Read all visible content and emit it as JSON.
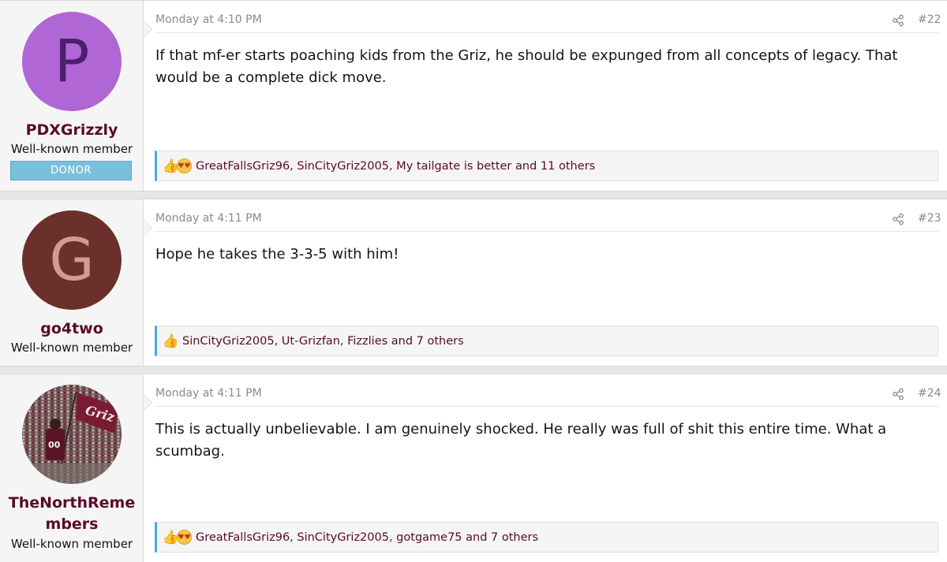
{
  "posts": [
    {
      "user": {
        "avatar_letter": "P",
        "avatar_bg": "#b066d4",
        "avatar_fg": "#4e1d6e",
        "username": "PDXGrizzly",
        "title": "Well-known member",
        "badge": "DONOR"
      },
      "date": "Monday at 4:10 PM",
      "number": "#22",
      "message": "If that mf-er starts poaching kids from the Griz, he should be expunged from all concepts of legacy. That would be a complete dick move.",
      "reactions": {
        "icons": [
          "like-icon",
          "love-icon"
        ],
        "text": "GreatFallsGriz96, SinCityGriz2005, My tailgate is better and 11 others"
      }
    },
    {
      "user": {
        "avatar_letter": "G",
        "avatar_bg": "#6b302b",
        "avatar_fg": "#d49a92",
        "username": "go4two",
        "title": "Well-known member"
      },
      "date": "Monday at 4:11 PM",
      "number": "#23",
      "message": "Hope he takes the 3-3-5 with him!",
      "reactions": {
        "icons": [
          "like-icon"
        ],
        "text": "SinCityGriz2005, Ut-Grizfan, Fizzlies and 7 others"
      }
    },
    {
      "user": {
        "username_line1": "TheNorthReme",
        "username_line2": "mbers",
        "title": "Well-known member"
      },
      "date": "Monday at 4:11 PM",
      "number": "#24",
      "message": "This is actually unbelievable. I am genuinely shocked. He really was full of shit this entire time. What a scumbag.",
      "reactions": {
        "icons": [
          "like-icon",
          "love-icon"
        ],
        "text": "GreatFallsGriz96, SinCityGriz2005, gotgame75 and 7 others"
      }
    }
  ],
  "colors": {
    "username": "#5a0a2a",
    "reaction_accent": "#47a7eb",
    "donor_badge": "#7ac0dc"
  }
}
